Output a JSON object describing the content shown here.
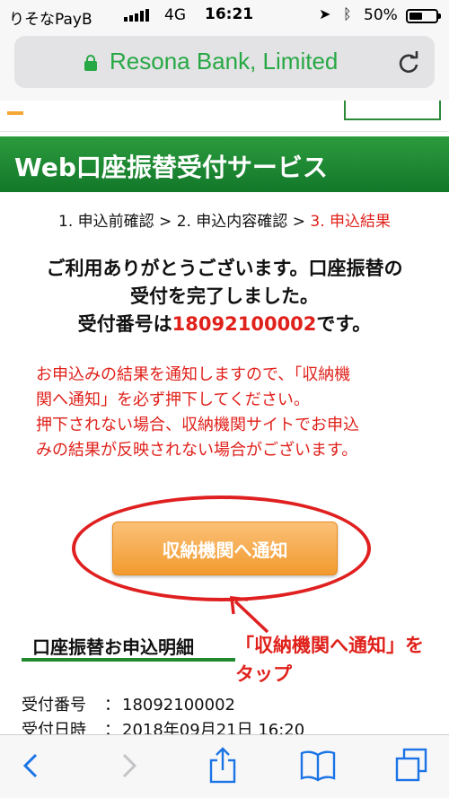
{
  "status_bar": {
    "carrier": "りそなPayB",
    "network": "4G",
    "time": "16:21",
    "battery": "50%",
    "battery_level": 0.5
  },
  "address_bar": {
    "site": "Resona Bank, Limited"
  },
  "page": {
    "title": "Web口座振替受付サービス",
    "steps": {
      "step1": "1. 申込前確認",
      "sep1": " > ",
      "step2": "2. 申込内容確認",
      "sep2": " > ",
      "step3": "3. 申込結果"
    },
    "thanks": {
      "line1": "ご利用ありがとうございます。口座振替の",
      "line2": "受付を完了しました。",
      "line3_prefix": "受付番号は",
      "reception_number": "18092100002",
      "line3_suffix": "です。"
    },
    "warning": {
      "line1": "お申込みの結果を通知しますので、「収納機",
      "line2": "関へ通知」を必ず押下してください。",
      "line3": "押下されない場合、収納機関サイトでお申込",
      "line4": "みの結果が反映されない場合がございます。"
    },
    "notify_button": "収納機関へ通知",
    "annotation": {
      "line1": "「収納機関へ通知」を",
      "line2": "タップ"
    },
    "section_heading": "口座振替お申込明細",
    "details": [
      {
        "key": "受付番号",
        "sep": "：",
        "value": "18092100002"
      },
      {
        "key": "受付日時",
        "sep": "：",
        "value": "2018年09月21日 16:20"
      }
    ]
  },
  "colors": {
    "brand_green": "#27a844",
    "alert_red": "#e0211b",
    "button_orange": "#f29a2e"
  }
}
